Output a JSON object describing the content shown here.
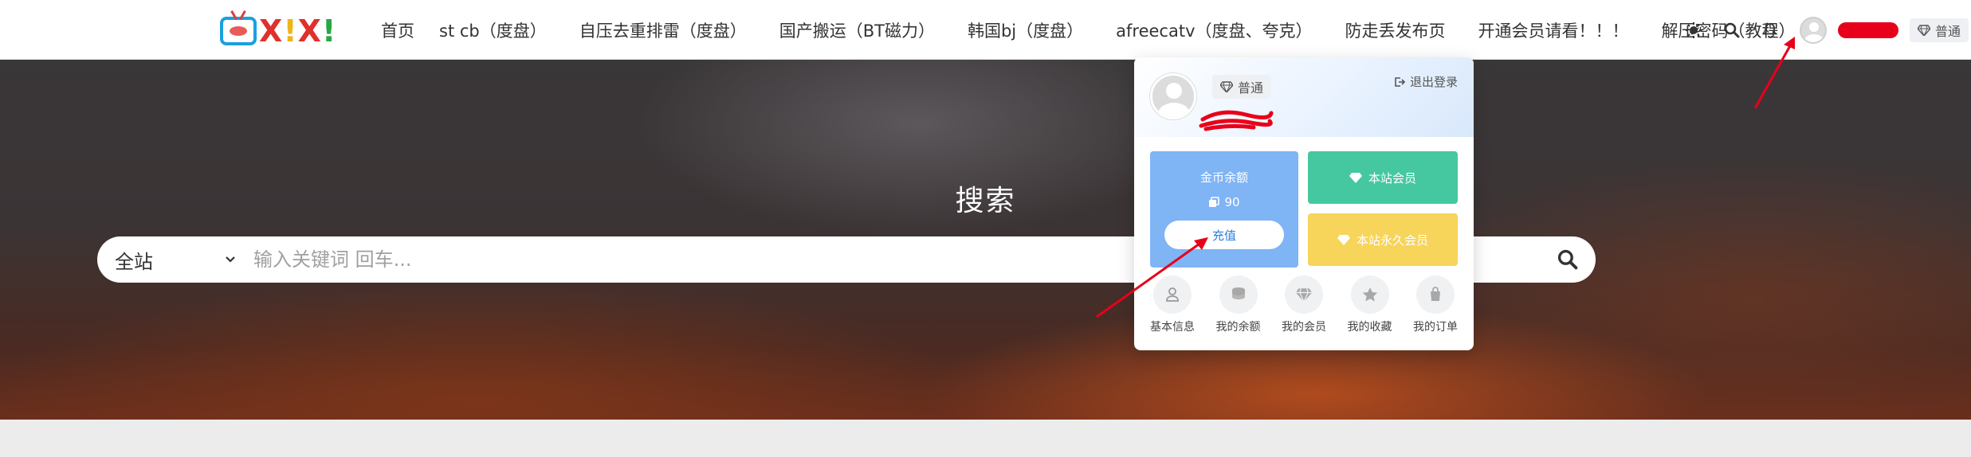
{
  "nav": {
    "items": [
      {
        "label": "首页"
      },
      {
        "label": "st cb（度盘）"
      },
      {
        "label": "自压去重排雷（度盘）"
      },
      {
        "label": "国产搬运（BT磁力）"
      },
      {
        "label": "韩国bj（度盘）"
      },
      {
        "label": "afreecatv（度盘、夸克）"
      },
      {
        "label": "防走丢发布页"
      },
      {
        "label": "开通会员请看！！！"
      },
      {
        "label": "解压密码（教程）"
      }
    ]
  },
  "user": {
    "level_badge": "普通"
  },
  "hero": {
    "title": "搜索",
    "scope": "全站",
    "placeholder": "输入关键词 回车..."
  },
  "panel": {
    "level_badge": "普通",
    "logout_label": "退出登录",
    "balance_label": "金币余额",
    "balance_value": "90",
    "recharge_label": "充值",
    "vip_label": "本站会员",
    "vip_permanent_label": "本站永久会员",
    "shortcuts": [
      {
        "label": "基本信息",
        "icon": "user-icon"
      },
      {
        "label": "我的余额",
        "icon": "coins-icon"
      },
      {
        "label": "我的会员",
        "icon": "diamond-icon"
      },
      {
        "label": "我的收藏",
        "icon": "star-icon"
      },
      {
        "label": "我的订单",
        "icon": "shopping-bag-icon"
      }
    ]
  },
  "colors": {
    "accent_blue": "#7fb4f5",
    "vip_green": "#45c8a0",
    "vip_yellow": "#f7d45a",
    "annotation_red": "#e8001a"
  }
}
